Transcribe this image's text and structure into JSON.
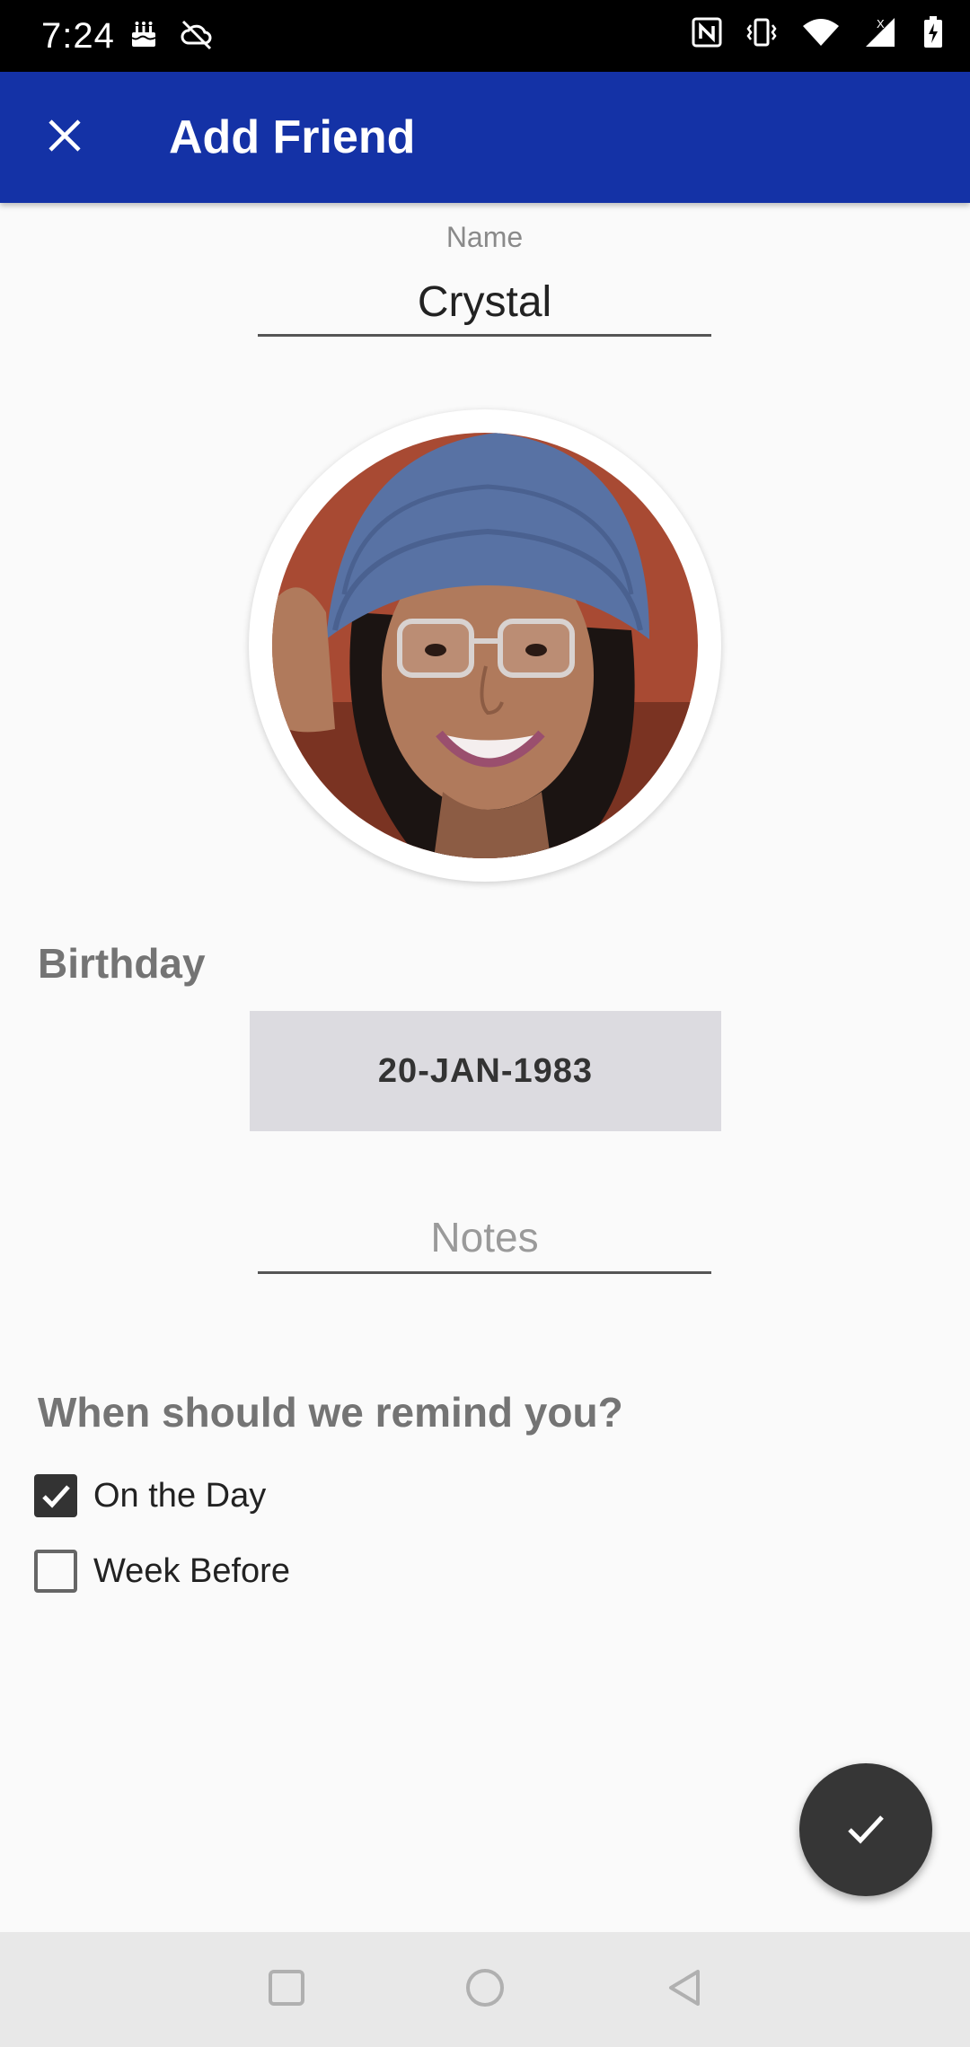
{
  "status_bar": {
    "time": "7:24",
    "left_icons": [
      "cake-notification-icon",
      "cloud-off-icon"
    ],
    "right_icons": [
      "nfc-icon",
      "vibrate-icon",
      "wifi-icon",
      "signal-icon",
      "battery-charging-icon"
    ]
  },
  "app_bar": {
    "title": "Add Friend",
    "close_icon": "close-icon",
    "color": "#1432a6"
  },
  "form": {
    "name": {
      "label": "Name",
      "value": "Crystal"
    },
    "avatar": {
      "icon": "profile-photo"
    },
    "birthday": {
      "heading": "Birthday",
      "date": "20-JAN-1983"
    },
    "notes": {
      "placeholder": "Notes",
      "value": ""
    },
    "reminders": {
      "heading": "When should we remind you?",
      "options": [
        {
          "label": "On the Day",
          "checked": true
        },
        {
          "label": "Week Before",
          "checked": false
        }
      ]
    }
  },
  "fab": {
    "icon": "check-icon"
  },
  "nav_bar": {
    "buttons": [
      "recents-square-icon",
      "home-circle-icon",
      "back-triangle-icon"
    ]
  }
}
